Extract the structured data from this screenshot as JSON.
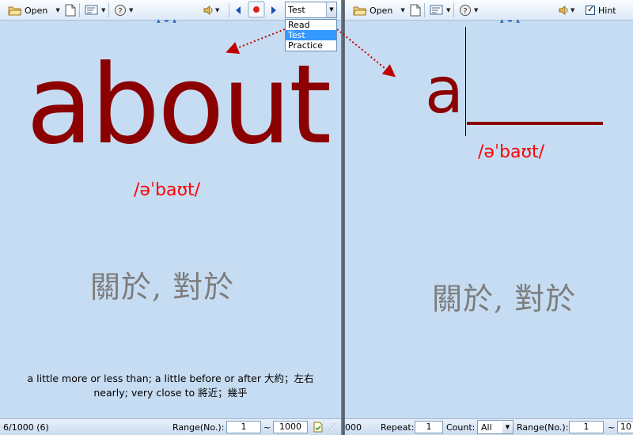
{
  "toolbar": {
    "open_label": "Open",
    "hint_label": "Hint"
  },
  "mode": {
    "selected": "Test",
    "options": [
      "Read",
      "Test",
      "Practice"
    ],
    "highlighted": "Test"
  },
  "left": {
    "word": "about",
    "phonetic": "/əˈbaʊt/",
    "chinese": "關於, 對於",
    "definition_line1": "a little more or less than; a little before or after 大約；左右",
    "definition_line2": "nearly; very close to 將近；幾乎"
  },
  "right": {
    "partial_word": "a",
    "phonetic": "/əˈbaʊt/",
    "chinese": "關於, 對於"
  },
  "status_left": {
    "position": "6/1000 (6)",
    "range_label": "Range(No.):",
    "range_from": "1",
    "tilde": "~",
    "range_to": "1000"
  },
  "status_right": {
    "total_fragment": "000",
    "repeat_label": "Repeat:",
    "repeat_value": "1",
    "count_label": "Count:",
    "count_value": "All",
    "range_label": "Range(No.):",
    "range_from": "1",
    "tilde": "~",
    "range_to_fragment": "10"
  },
  "colors": {
    "word": "#8b0000",
    "phonetic": "#ff0000",
    "chinese": "#7d7d7d",
    "background": "#c6dcf2",
    "selection": "#3399ff"
  },
  "icons": [
    "open-folder-icon",
    "new-document-icon",
    "card-settings-icon",
    "help-icon",
    "speaker-icon",
    "previous-icon",
    "record-icon",
    "next-icon",
    "go-to-icon"
  ]
}
